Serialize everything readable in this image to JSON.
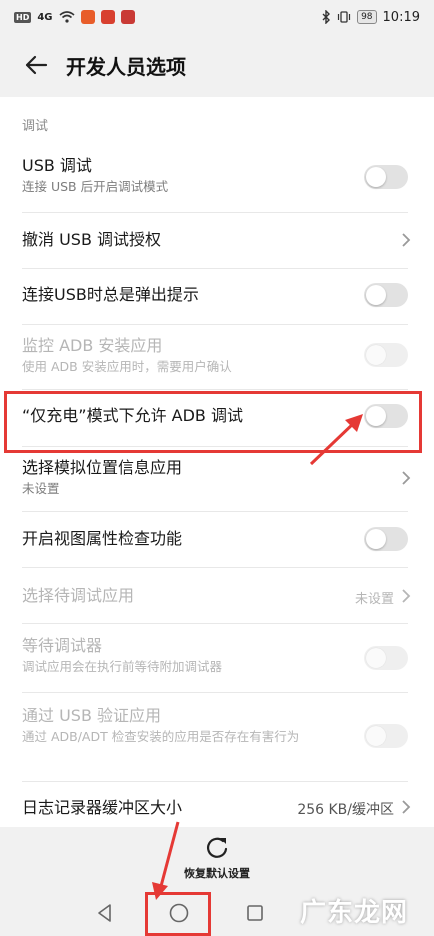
{
  "status_bar": {
    "hd": "HD",
    "signal": "4G",
    "battery": "98",
    "time": "10:19"
  },
  "header": {
    "title": "开发人员选项"
  },
  "section": {
    "label": "调试"
  },
  "rows": {
    "usb_debug": {
      "title": "USB 调试",
      "subtitle": "连接 USB 后开启调试模式"
    },
    "revoke_usb": {
      "title": "撤消 USB 调试授权"
    },
    "usb_prompt": {
      "title": "连接USB时总是弹出提示"
    },
    "monitor_adb": {
      "title": "监控 ADB 安装应用",
      "subtitle": "使用 ADB 安装应用时，需要用户确认"
    },
    "charge_only_adb": {
      "title": "“仅充电”模式下允许 ADB 调试"
    },
    "mock_location": {
      "title": "选择模拟位置信息应用",
      "subtitle": "未设置"
    },
    "view_attr": {
      "title": "开启视图属性检查功能"
    },
    "debug_app": {
      "title": "选择待调试应用",
      "value": "未设置"
    },
    "wait_debugger": {
      "title": "等待调试器",
      "subtitle": "调试应用会在执行前等待附加调试器"
    },
    "verify_usb": {
      "title": "通过 USB 验证应用",
      "subtitle": "通过 ADB/ADT 检查安装的应用是否存在有害行为"
    },
    "logger_buffer": {
      "title": "日志记录器缓冲区大小",
      "value": "256 KB/缓冲区"
    }
  },
  "restore": {
    "label": "恢复默认设置"
  },
  "watermark": {
    "text": "广东龙网"
  },
  "colors": {
    "accent_red": "#e53935",
    "toggle_off": "#e2e2e2"
  }
}
